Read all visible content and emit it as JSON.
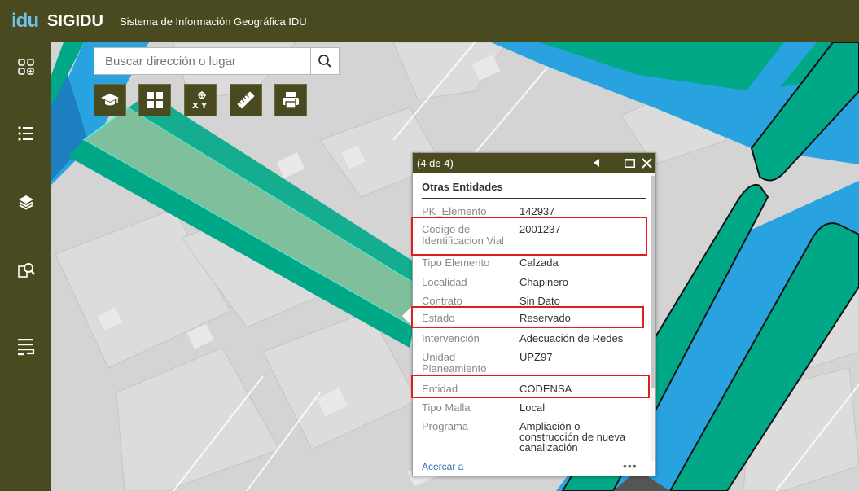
{
  "header": {
    "logo": "idu",
    "app_name": "SIGIDU",
    "subtitle": "Sistema de Información Geográfica IDU"
  },
  "sidebar": {
    "items": [
      {
        "name": "widgets",
        "icon": "apps-grid-icon"
      },
      {
        "name": "legend",
        "icon": "list-icon"
      },
      {
        "name": "layers",
        "icon": "layers-icon"
      },
      {
        "name": "query",
        "icon": "search-document-icon"
      },
      {
        "name": "attribute-table",
        "icon": "table-list-icon"
      }
    ]
  },
  "search": {
    "placeholder": "Buscar dirección o lugar",
    "icon": "search-icon"
  },
  "toolbar": {
    "items": [
      {
        "name": "basemap",
        "icon": "graduation-cap-icon"
      },
      {
        "name": "layout",
        "icon": "grid-icon"
      },
      {
        "name": "coordinates",
        "icon": "xy-coordinates-icon"
      },
      {
        "name": "measure",
        "icon": "ruler-icon"
      },
      {
        "name": "print",
        "icon": "printer-icon"
      }
    ]
  },
  "popup": {
    "count": "(4 de 4)",
    "title": "Otras Entidades",
    "attributes": [
      {
        "key": "PK_Elemento",
        "value": "142937"
      },
      {
        "key": "Codigo de Identificacion Vial",
        "value": "2001237"
      },
      {
        "key": "Tipo Elemento",
        "value": "Calzada"
      },
      {
        "key": "Localidad",
        "value": "Chapinero"
      },
      {
        "key": "Contrato",
        "value": "Sin Dato"
      },
      {
        "key": "Estado",
        "value": "Reservado"
      },
      {
        "key": "Intervención",
        "value": "Adecuación de Redes"
      },
      {
        "key": "Unidad Planeamiento",
        "value": "UPZ97"
      },
      {
        "key": "Entidad",
        "value": "CODENSA"
      },
      {
        "key": "Tipo Malla",
        "value": "Local"
      },
      {
        "key": "Programa",
        "value": "Ampliación o construcción de nueva canalización"
      }
    ],
    "zoom_link": "Acercar a",
    "more": "•••"
  },
  "colors": {
    "header_bg": "#4a4a20",
    "road_green": "#00a887",
    "road_blue": "#29a3e0",
    "selected_fill": "#7fbf9c",
    "highlight_red": "#e01e1e"
  }
}
